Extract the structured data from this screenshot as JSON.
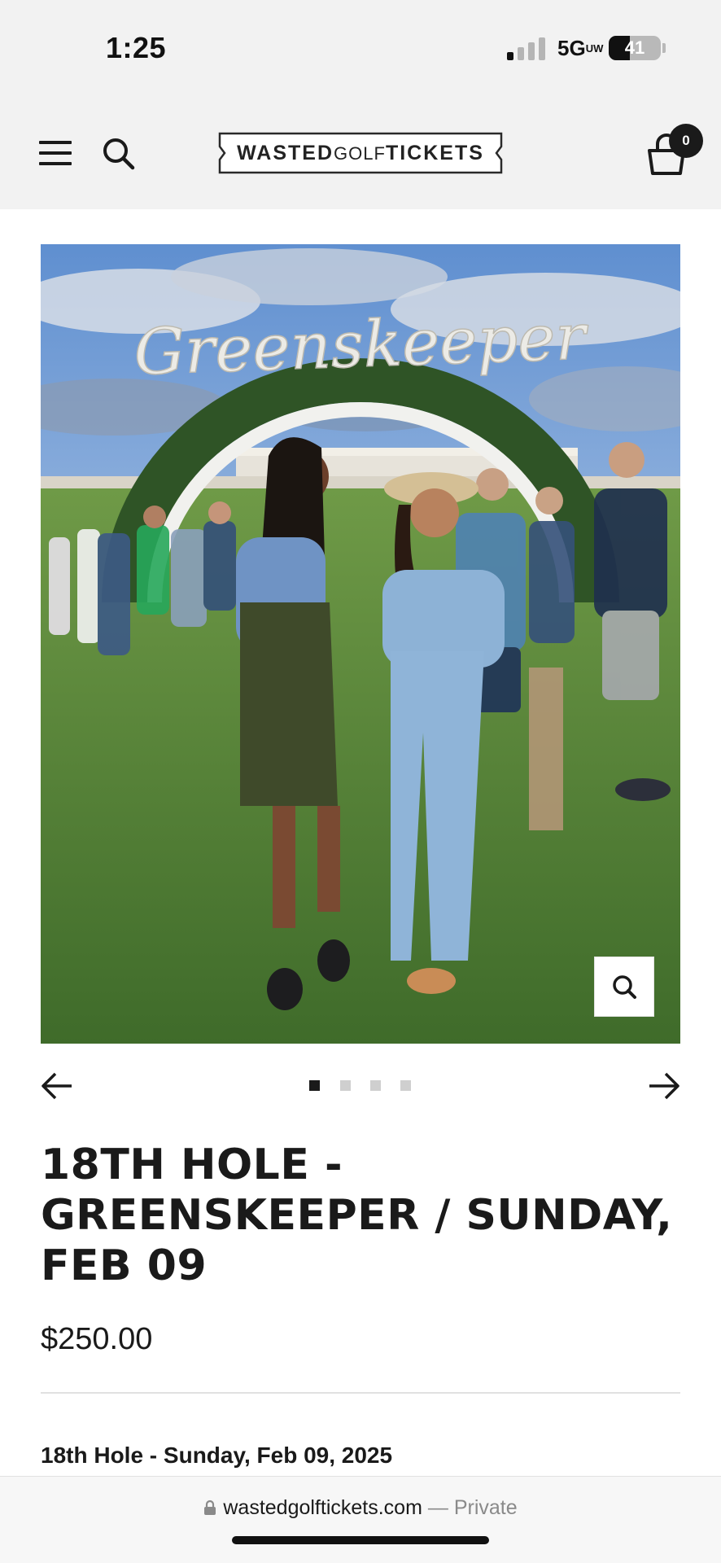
{
  "status_bar": {
    "time": "1:25",
    "network": "5G",
    "network_suffix": "UW",
    "battery": "41",
    "battery_level": 0.41
  },
  "header": {
    "logo": {
      "part1": "WASTED",
      "part2": "GOLF",
      "part3": "TICKETS"
    },
    "cart_count": "0",
    "icons": {
      "menu": "hamburger-menu-icon",
      "search": "search-icon",
      "cart": "shopping-bag-icon"
    }
  },
  "product": {
    "image_sign_text": "Greenskeeper",
    "gallery": {
      "count": 4,
      "active_index": 0
    },
    "title": "18TH HOLE - GREENSKEEPER / SUNDAY, FEB 09",
    "price": "$250.00",
    "variant_label": "18th Hole - Sunday, Feb 09, 2025"
  },
  "browser": {
    "domain": "wastedgolftickets.com",
    "separator": " — ",
    "mode": "Private"
  },
  "colors": {
    "header_bg": "#f2f2f2",
    "text": "#1a1a1a",
    "dot_active": "#1a1a1a",
    "dot_inactive": "#cfcfcf"
  }
}
